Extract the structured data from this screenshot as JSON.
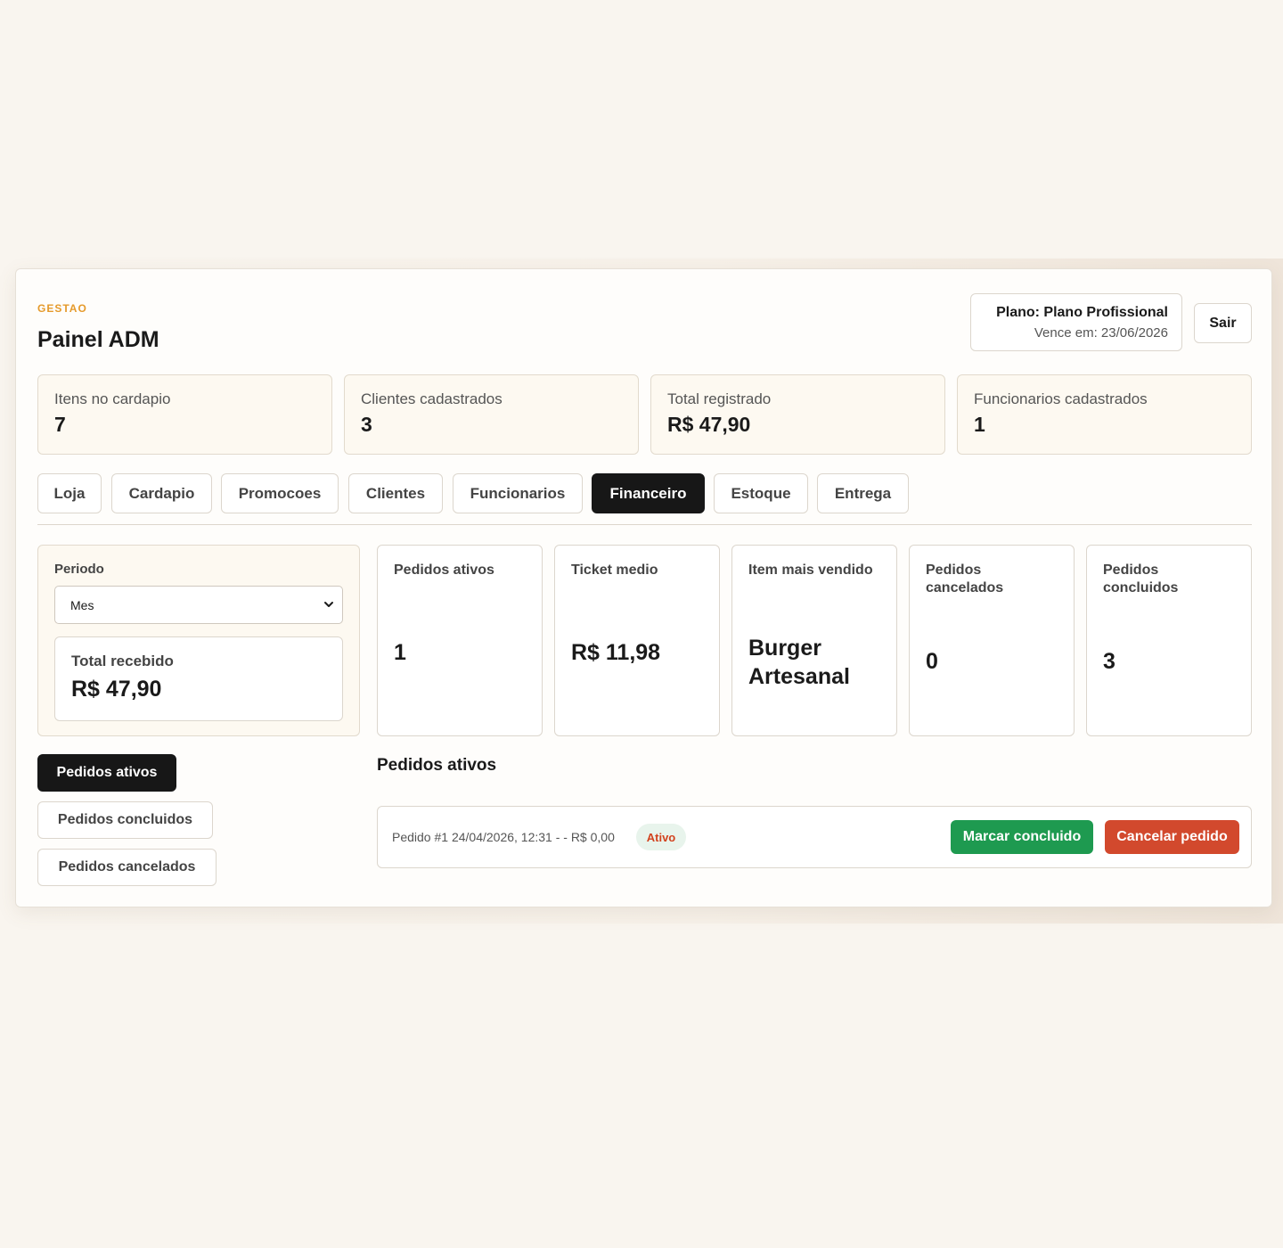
{
  "header": {
    "eyebrow": "GESTAO",
    "title": "Painel ADM",
    "plan_label": "Plano: Plano Profissional",
    "plan_expiry": "Vence em: 23/06/2026",
    "logout_label": "Sair"
  },
  "stats": [
    {
      "label": "Itens no cardapio",
      "value": "7"
    },
    {
      "label": "Clientes cadastrados",
      "value": "3"
    },
    {
      "label": "Total registrado",
      "value": "R$ 47,90"
    },
    {
      "label": "Funcionarios cadastrados",
      "value": "1"
    }
  ],
  "tabs": [
    {
      "label": "Loja"
    },
    {
      "label": "Cardapio"
    },
    {
      "label": "Promocoes"
    },
    {
      "label": "Clientes"
    },
    {
      "label": "Funcionarios"
    },
    {
      "label": "Financeiro",
      "active": true
    },
    {
      "label": "Estoque"
    },
    {
      "label": "Entrega"
    }
  ],
  "period": {
    "label": "Periodo",
    "selected": "Mes"
  },
  "total_received": {
    "label": "Total recebido",
    "value": "R$ 47,90"
  },
  "metrics": [
    {
      "label": "Pedidos ativos",
      "value": "1"
    },
    {
      "label": "Ticket medio",
      "value": "R$ 11,98"
    },
    {
      "label": "Item mais vendido",
      "value": "Burger Artesanal"
    },
    {
      "label": "Pedidos cancelados",
      "value": "0"
    },
    {
      "label": "Pedidos concluidos",
      "value": "3"
    }
  ],
  "side_filters": [
    {
      "label": "Pedidos ativos",
      "active": true
    },
    {
      "label": "Pedidos concluidos"
    },
    {
      "label": "Pedidos cancelados"
    }
  ],
  "orders": {
    "title": "Pedidos ativos",
    "items": [
      {
        "summary": "Pedido #1 24/04/2026, 12:31 - - R$ 0,00",
        "status": "Ativo",
        "complete_label": "Marcar concluido",
        "cancel_label": "Cancelar pedido"
      }
    ]
  },
  "colors": {
    "accent": "#e59a2b",
    "active_dark": "#171717",
    "success": "#1e9a50",
    "danger": "#d2492d",
    "background": "#f9f5ef"
  }
}
